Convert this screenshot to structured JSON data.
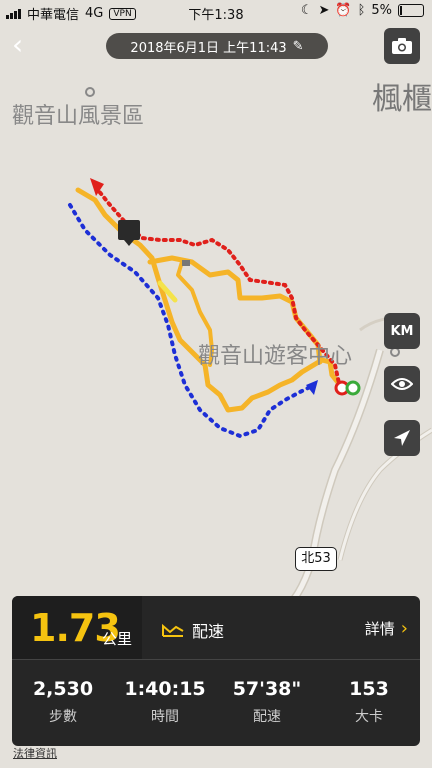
{
  "status_bar": {
    "carrier": "中華電信",
    "network": "4G",
    "vpn": "VPN",
    "time": "下午1:38",
    "battery": "5%"
  },
  "header": {
    "date_time": "2018年6月1日 上午11:43"
  },
  "map": {
    "labels": {
      "area": "觀音山風景區",
      "visitor_center": "觀音山遊客中心",
      "top_right": "楓櫃"
    },
    "road_badge": "北53",
    "side_buttons": {
      "km": "KM"
    }
  },
  "summary": {
    "distance_value": "1.73",
    "distance_unit": "公里",
    "pace_tab": "配速",
    "detail_link": "詳情",
    "stats": [
      {
        "value": "2,530",
        "label": "步數"
      },
      {
        "value": "1:40:15",
        "label": "時間"
      },
      {
        "value": "57'38\"",
        "label": "配速"
      },
      {
        "value": "153",
        "label": "大卡"
      }
    ]
  },
  "footer": {
    "legal": "法律資訊"
  },
  "colors": {
    "route": "#f5b428",
    "red_dots": "#e0201b",
    "blue_dots": "#1d2fd6",
    "accent": "#f5c310",
    "start_green": "#3aaa3a"
  }
}
